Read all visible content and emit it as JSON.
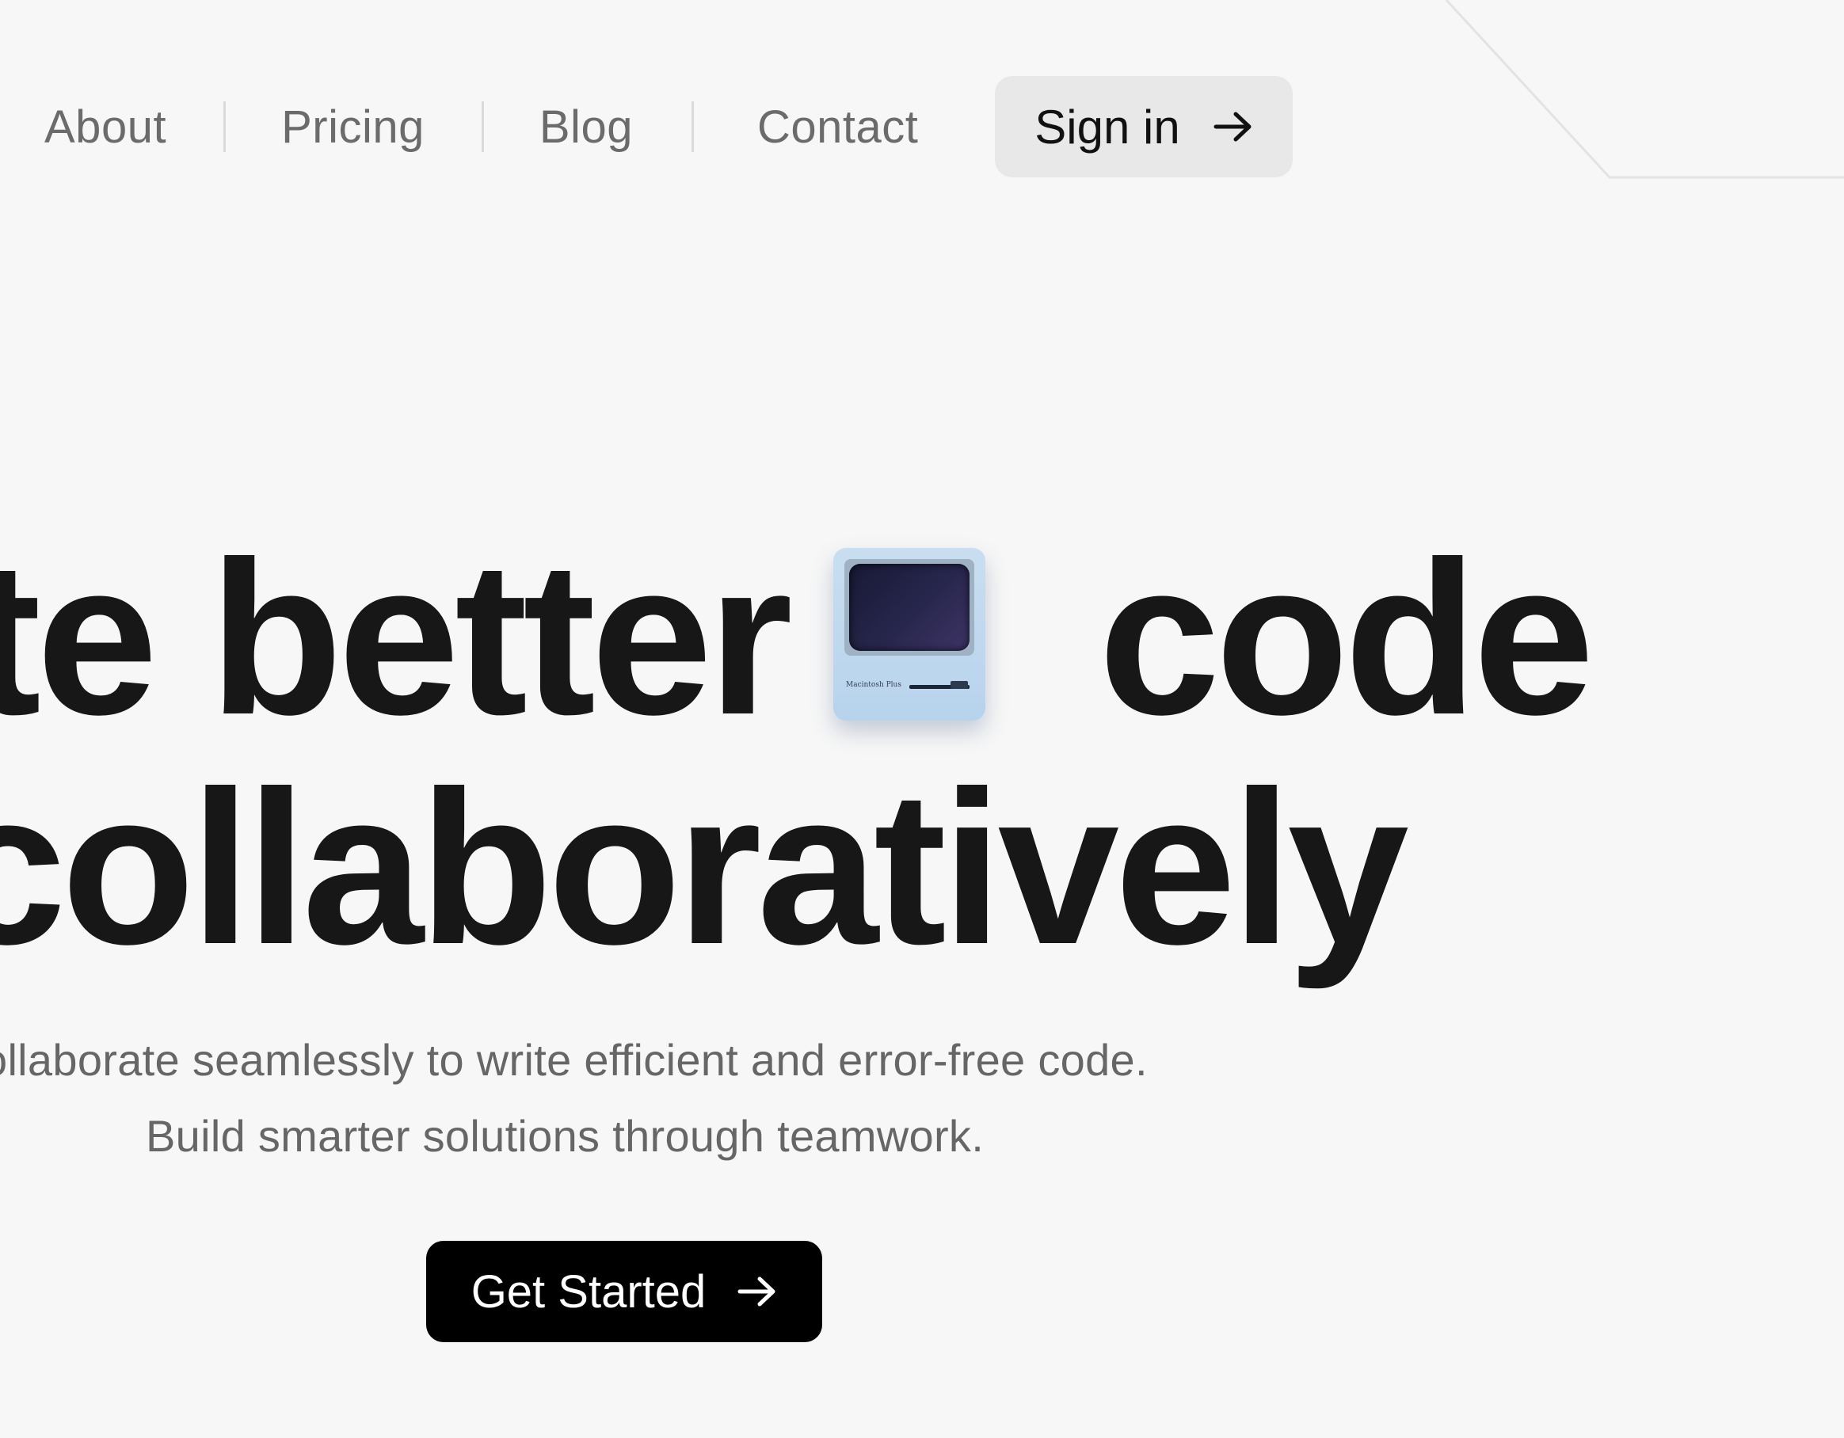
{
  "nav": {
    "items": [
      {
        "label": "About"
      },
      {
        "label": "Pricing"
      },
      {
        "label": "Blog"
      },
      {
        "label": "Contact"
      }
    ],
    "signin_label": "Sign in"
  },
  "hero": {
    "line1_start": "te better",
    "line1_end": "code",
    "line2": "collaboratively",
    "icon": "macintosh-computer-icon",
    "icon_badge": "Macintosh Plus",
    "subtitle_1": "ollaborate seamlessly to write efficient and error-free code.",
    "subtitle_2": "Build smarter solutions through teamwork.",
    "cta_label": "Get Started"
  },
  "colors": {
    "background": "#f7f7f7",
    "text": "#171717",
    "muted": "#6b6b6b",
    "signin_bg": "#e8e8e8",
    "cta_bg": "#000000"
  }
}
